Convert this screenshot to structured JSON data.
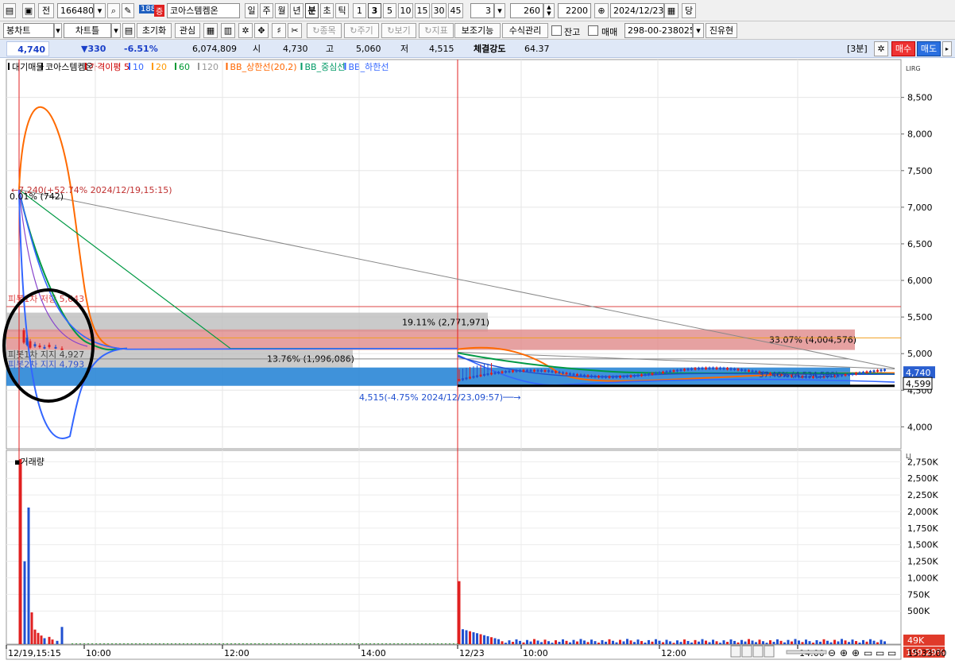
{
  "toolbar1": {
    "prev_label": "전",
    "stock_code": "166480",
    "stock_badge": "188",
    "stock_tag": "증",
    "stock_name": "코아스템켐온",
    "periods": [
      "일",
      "주",
      "월",
      "년",
      "분",
      "초",
      "틱"
    ],
    "selected_period": "분",
    "intervals": [
      "1",
      "3",
      "5",
      "10",
      "15",
      "30",
      "45"
    ],
    "selected_interval": "3",
    "interval_value": "3",
    "count_value": "260",
    "view_value": "2200",
    "date_value": "2024/12/23",
    "today_label": "당"
  },
  "toolbar2": {
    "chart_type": "봉차트",
    "chart_tools": "차트틀",
    "reset_label": "초기화",
    "interest_label": "관심",
    "grayed": [
      "종목",
      "주기",
      "보기",
      "지표"
    ],
    "aux_label": "보조기능",
    "formula_label": "수식관리",
    "balance_label": "잔고",
    "trade_label": "매매",
    "account": "298-00-238025",
    "user": "진유현"
  },
  "info": {
    "price": "4,740",
    "change": "▼330",
    "change_pct": "-6.51%",
    "volume": "6,074,809",
    "open_label": "시",
    "open": "4,730",
    "high_label": "고",
    "high": "5,060",
    "low_label": "저",
    "low": "4,515",
    "strength_label": "체결강도",
    "strength": "64.37",
    "period_tag": "[3분]",
    "buy_label": "매수",
    "sell_label": "매도"
  },
  "legend": {
    "items": [
      "대기매물",
      "코아스템켐온",
      "가격이평 5",
      "10",
      "20",
      "60",
      "120",
      "BB_상한선(20,2)",
      "BB_중심선",
      "BB_하한선"
    ],
    "colors": [
      "#000000",
      "#000000",
      "#cc0000",
      "#3366ff",
      "#ff9900",
      "#009933",
      "#999999",
      "#ff6600",
      "#009966",
      "#3366ff"
    ]
  },
  "price_axis": {
    "ticks": [
      "8,500",
      "8,000",
      "7,500",
      "7,000",
      "6,500",
      "6,000",
      "5,500",
      "5,000",
      "4,500",
      "4,000"
    ],
    "current": "4,740",
    "marker": "4,599"
  },
  "volume_axis": {
    "ticks": [
      "2,750K",
      "2,500K",
      "2,250K",
      "2,000K",
      "1,750K",
      "1,500K",
      "1,250K",
      "1,000K",
      "750K",
      "500K"
    ],
    "current": "49K",
    "ratio": "199.29%"
  },
  "time_axis": {
    "labels": [
      "12/19,15:15",
      "10:00",
      "12:00",
      "14:00",
      "12/23",
      "10:00",
      "12:00",
      "14:00"
    ],
    "clock": "15:33:00"
  },
  "annotations": {
    "high_note": "7,240(+52.74% 2024/12/19,15:15)",
    "pct_note": "0.01% (742)",
    "resist": "피봇1차 저항 5,643",
    "support1": "피봇1차 지지 4,927",
    "support2": "피봇2차 지지 4,793",
    "low_note": "4,515(-4.75% 2024/12/23,09:57)",
    "vp1": "19.11% (2,771,971)",
    "vp2": "33.07% (4,004,576)",
    "vp3": "13.76% (1,996,086)",
    "vp4": "37.46% (4,534,580)",
    "volume_title": "거래량"
  },
  "chart_data": {
    "type": "candlestick",
    "interval": "3분",
    "price_range": [
      3700,
      8800
    ],
    "volume_range": [
      0,
      2850000
    ],
    "last_price": 4740,
    "high": 7240,
    "low": 4515,
    "pivot_resistance_1": 5643,
    "pivot_support_1": 4927,
    "pivot_support_2": 4793,
    "volume_profile": [
      {
        "pct": 19.11,
        "volume": 2771971,
        "price_from": 5300,
        "price_to": 5560
      },
      {
        "pct": 33.07,
        "volume": 4004576,
        "price_from": 5050,
        "price_to": 5330
      },
      {
        "pct": 13.76,
        "volume": 1996086,
        "price_from": 4810,
        "price_to": 5050
      },
      {
        "pct": 37.46,
        "volume": 4534580,
        "price_from": 4560,
        "price_to": 4810
      }
    ],
    "volume_last": 49000
  },
  "colors": {
    "up": "#e02020",
    "down": "#2050d0",
    "infobar": "#dfe8f7"
  }
}
